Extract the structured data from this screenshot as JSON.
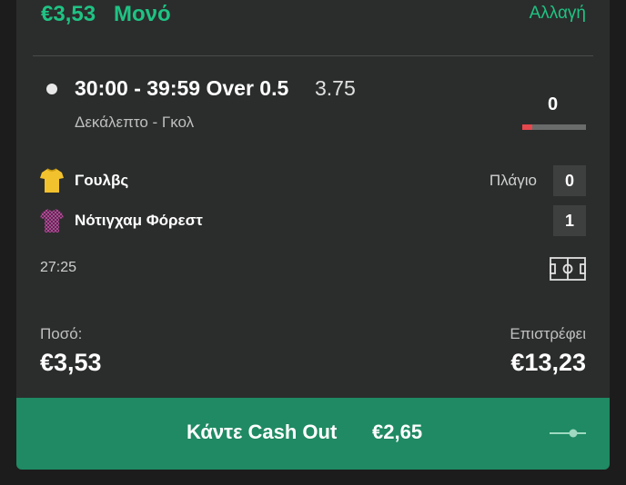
{
  "header": {
    "stake": "€3,53",
    "bet_type": "Μονό",
    "change_label": "Αλλαγή"
  },
  "selection": {
    "title": "30:00 - 39:59 Over 0.5",
    "odds": "3.75",
    "market": "Δεκάλεπτο - Γκολ",
    "goal_count": "0",
    "progress_fraction": 0.15,
    "progress_color": "#e5484d"
  },
  "match": {
    "teams": [
      {
        "name": "Γουλβς",
        "score": "0",
        "jersey_icon": "jersey-yellow-icon"
      },
      {
        "name": "Νότιγχαμ Φόρεστ",
        "score": "1",
        "jersey_icon": "jersey-checkered-icon"
      }
    ],
    "corner_label": "Πλάγιο",
    "time": "27:25",
    "pitch_icon": "pitch-icon"
  },
  "summary": {
    "stake_label": "Ποσό:",
    "stake_value": "€3,53",
    "returns_label": "Επιστρέφει",
    "returns_value": "€13,23"
  },
  "cashout": {
    "label": "Κάντε Cash Out",
    "amount": "€2,65",
    "slider_icon": "slider-icon"
  },
  "colors": {
    "accent": "#1fc384",
    "cashout_bg": "#1f8a63",
    "card_bg": "#2b2d2c"
  }
}
